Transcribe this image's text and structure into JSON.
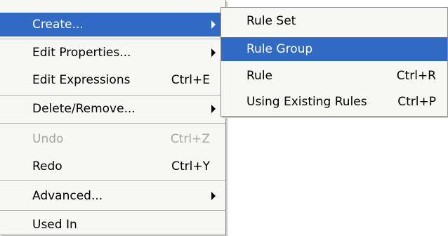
{
  "context_menu": {
    "items": [
      {
        "label": "Create...",
        "has_submenu": true,
        "highlighted": true
      },
      {
        "label": "Edit Properties...",
        "has_submenu": true
      },
      {
        "label": "Edit Expressions",
        "shortcut": "Ctrl+E"
      },
      {
        "label": "Delete/Remove...",
        "has_submenu": true
      },
      {
        "label": "Undo",
        "shortcut": "Ctrl+Z",
        "disabled": true
      },
      {
        "label": "Redo",
        "shortcut": "Ctrl+Y"
      },
      {
        "label": "Advanced...",
        "has_submenu": true
      },
      {
        "label": "Used In"
      }
    ]
  },
  "submenu": {
    "items": [
      {
        "label": "Rule Set"
      },
      {
        "label": "Rule Group",
        "highlighted": true
      },
      {
        "label": "Rule",
        "shortcut": "Ctrl+R"
      },
      {
        "label": "Using Existing Rules",
        "shortcut": "Ctrl+P"
      }
    ]
  },
  "colors": {
    "highlight": "#316ac5",
    "menu_background": "#f7f7f4",
    "disabled_text": "#a7a69f"
  }
}
